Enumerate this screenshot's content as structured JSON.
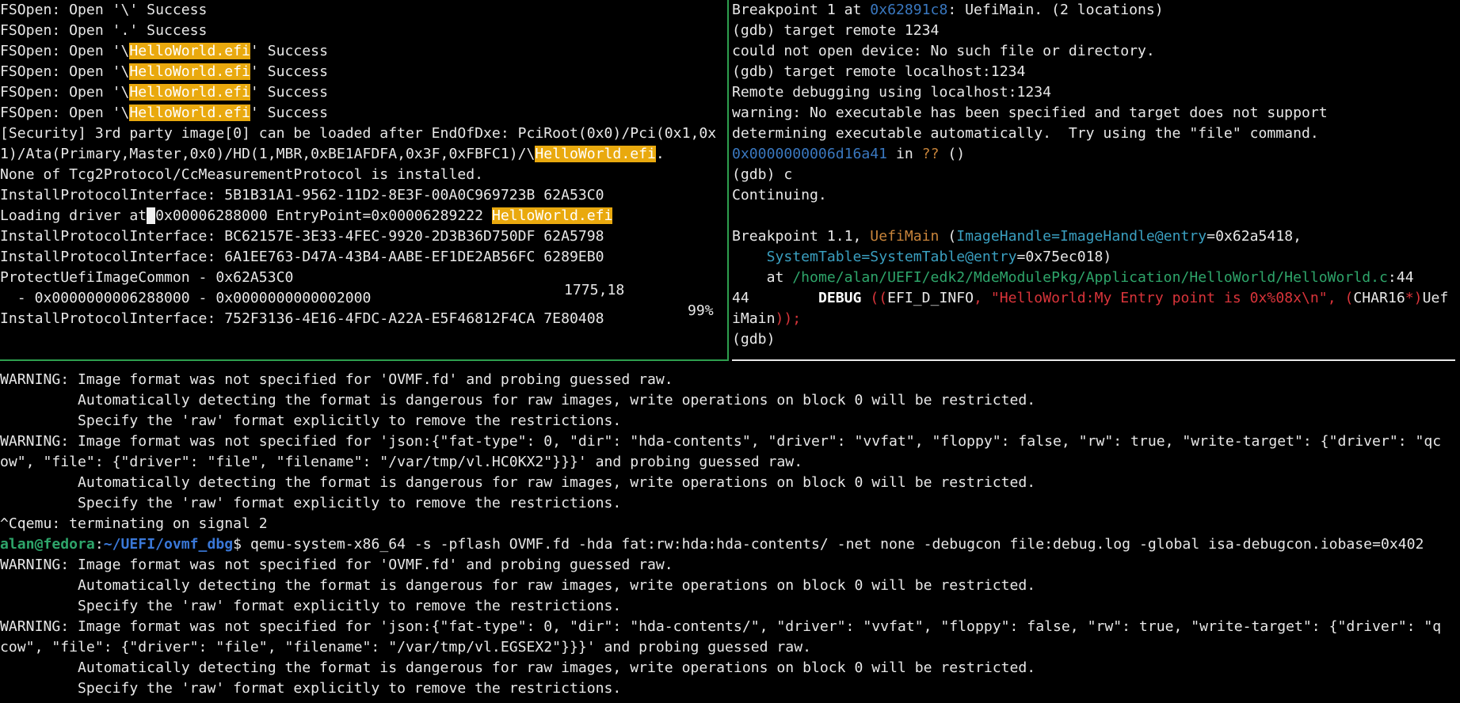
{
  "left_pane": {
    "lines": [
      "FSOpen: Open '\\' Success",
      "FSOpen: Open '.' Success",
      [
        "FSOpen: Open '\\",
        "HelloWorld.efi",
        "' Success"
      ],
      [
        "FSOpen: Open '\\",
        "HelloWorld.efi",
        "' Success"
      ],
      [
        "FSOpen: Open '\\",
        "HelloWorld.efi",
        "' Success"
      ],
      [
        "FSOpen: Open '\\",
        "HelloWorld.efi",
        "' Success"
      ],
      "[Security] 3rd party image[0] can be loaded after EndOfDxe: PciRoot(0x0)/Pci(0x1,0x",
      [
        "1)/Ata(Primary,Master,0x0)/HD(1,MBR,0xBE1AFDFA,0x3F,0xFBFC1)/\\",
        "HelloWorld.efi",
        "."
      ],
      "None of Tcg2Protocol/CcMeasurementProtocol is installed.",
      "InstallProtocolInterface: 5B1B31A1-9562-11D2-8E3F-00A0C969723B 62A53C0",
      "Loading driver at",
      "InstallProtocolInterface: BC62157E-3E33-4FEC-9920-2D3B36D750DF 62A5798",
      "InstallProtocolInterface: 6A1EE763-D47A-43B4-AABE-EF1DE2AB56FC 6289EB0",
      "ProtectUefiImageCommon - 0x62A53C0",
      "  - 0x0000000006288000 - 0x0000000000002000",
      "InstallProtocolInterface: 752F3136-4E16-4FDC-A22A-E5F46812F4CA 7E80408"
    ],
    "loading_line": {
      "prefix": "Loading driver at",
      "cursor": " ",
      "addr": "0x00006288000 EntryPoint=0x00006289222 ",
      "file": "HelloWorld.efi"
    },
    "status_position": "1775,18",
    "status_percent": "99%"
  },
  "right_pane": {
    "bp_prefix": "Breakpoint 1 at ",
    "bp_addr": "0x62891c8",
    "bp_suffix": ": UefiMain. (2 locations)",
    "l2": "(gdb) target remote 1234",
    "l3": "could not open device: No such file or directory.",
    "l4": "(gdb) target remote localhost:1234",
    "l5": "Remote debugging using localhost:1234",
    "l6": "warning: No executable has been specified and target does not support",
    "l7": "determining executable automatically.  Try using the \"file\" command.",
    "pc_addr": "0x0000000006d16a41",
    "pc_in": " in ",
    "pc_q": "??",
    "pc_tail": " ()",
    "l9": "(gdb) c",
    "l10": "Continuing.",
    "bp11_prefix": "Breakpoint 1.1, ",
    "bp11_func": "UefiMain",
    "bp11_open": " (",
    "bp11_param": "ImageHandle=ImageHandle@entry",
    "bp11_val": "=0x62a5418,",
    "bp12_indent": "    ",
    "bp12_param": "SystemTable=SystemTable@entry",
    "bp12_val": "=0x75ec018)",
    "at_prefix": "    at ",
    "at_path": "/home/alan/UEFI/edk2/MdeModulePkg/Application/HelloWorld/HelloWorld.c",
    "at_line": ":44",
    "src_num": "44        ",
    "src_debug": "DEBUG",
    "src_sp": " ",
    "src_p1": "((",
    "src_info": "EFI_D_INFO",
    "src_comma": ", ",
    "src_str": "\"HelloWorld:My Entry point is 0x%08x\\n\"",
    "src_comma2": ", ",
    "src_p2": "(",
    "src_type": "CHAR16",
    "src_star": "*)",
    "src_tail": "Uef",
    "src2_text": "iMain",
    "src2_close": "));",
    "prompt": "(gdb)"
  },
  "bottom_pane": {
    "w1": "WARNING: Image format was not specified for 'OVMF.fd' and probing guessed raw.",
    "w1a": "         Automatically detecting the format is dangerous for raw images, write operations on block 0 will be restricted.",
    "w1b": "         Specify the 'raw' format explicitly to remove the restrictions.",
    "w2": "WARNING: Image format was not specified for 'json:{\"fat-type\": 0, \"dir\": \"hda-contents\", \"driver\": \"vvfat\", \"floppy\": false, \"rw\": true, \"write-target\": {\"driver\": \"qc",
    "w2c": "ow\", \"file\": {\"driver\": \"file\", \"filename\": \"/var/tmp/vl.HC0KX2\"}}}' and probing guessed raw.",
    "w2a": "         Automatically detecting the format is dangerous for raw images, write operations on block 0 will be restricted.",
    "w2b": "         Specify the 'raw' format explicitly to remove the restrictions.",
    "term": "^Cqemu: terminating on signal 2",
    "prompt_user": "alan@fedora",
    "prompt_sep": ":",
    "prompt_path": "~/UEFI/ovmf_dbg",
    "prompt_dollar": "$ ",
    "command": "qemu-system-x86_64 -s -pflash OVMF.fd -hda fat:rw:hda:hda-contents/ -net none -debugcon file:debug.log -global isa-debugcon.iobase=0x402",
    "w3": "WARNING: Image format was not specified for 'OVMF.fd' and probing guessed raw.",
    "w3a": "         Automatically detecting the format is dangerous for raw images, write operations on block 0 will be restricted.",
    "w3b": "         Specify the 'raw' format explicitly to remove the restrictions.",
    "w4": "WARNING: Image format was not specified for 'json:{\"fat-type\": 0, \"dir\": \"hda-contents/\", \"driver\": \"vvfat\", \"floppy\": false, \"rw\": true, \"write-target\": {\"driver\": \"q",
    "w4c": "cow\", \"file\": {\"driver\": \"file\", \"filename\": \"/var/tmp/vl.EGSEX2\"}}}' and probing guessed raw.",
    "w4a": "         Automatically detecting the format is dangerous for raw images, write operations on block 0 will be restricted.",
    "w4b": "         Specify the 'raw' format explicitly to remove the restrictions."
  },
  "colors": {
    "background": "#000000",
    "foreground": "#e8e8e8",
    "highlight": "#e9a90e",
    "split_border": "#2e9f4e",
    "address": "#3a78c0",
    "string": "#d9343a",
    "path": "#2ea56a"
  }
}
